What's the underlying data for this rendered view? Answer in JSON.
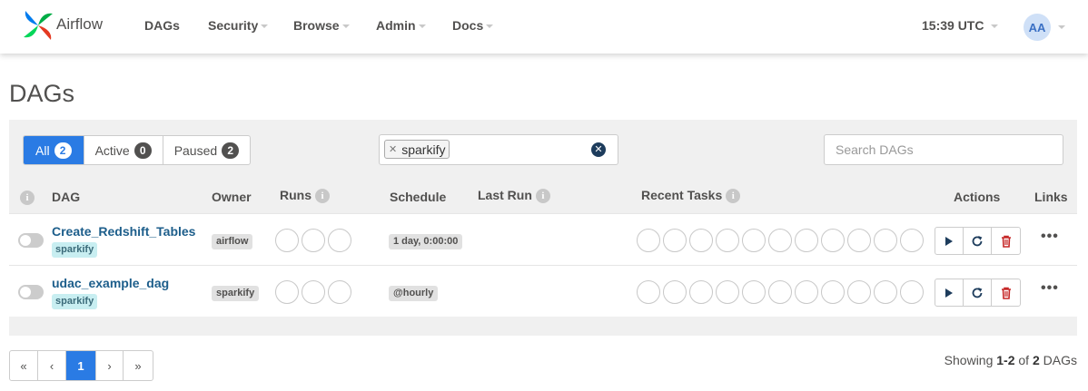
{
  "navbar": {
    "brand": "Airflow",
    "items": [
      {
        "label": "DAGs",
        "caret": false
      },
      {
        "label": "Security",
        "caret": true
      },
      {
        "label": "Browse",
        "caret": true
      },
      {
        "label": "Admin",
        "caret": true
      },
      {
        "label": "Docs",
        "caret": true
      }
    ],
    "clock": "15:39 UTC",
    "avatar_initials": "AA"
  },
  "page_title": "DAGs",
  "filters": {
    "all": {
      "label": "All",
      "count": "2"
    },
    "active": {
      "label": "Active",
      "count": "0"
    },
    "paused": {
      "label": "Paused",
      "count": "2"
    },
    "tag_filter": "sparkify",
    "search_placeholder": "Search DAGs"
  },
  "columns": {
    "dag": "DAG",
    "owner": "Owner",
    "runs": "Runs",
    "schedule": "Schedule",
    "last_run": "Last Run",
    "recent_tasks": "Recent Tasks",
    "actions": "Actions",
    "links": "Links"
  },
  "dags": [
    {
      "name": "Create_Redshift_Tables",
      "tag": "sparkify",
      "owner": "airflow",
      "schedule": "1 day, 0:00:00",
      "last_run": ""
    },
    {
      "name": "udac_example_dag",
      "tag": "sparkify",
      "owner": "sparkify",
      "schedule": "@hourly",
      "last_run": ""
    }
  ],
  "icons": {
    "info": "info-icon",
    "trigger": "play-icon",
    "refresh": "refresh-icon",
    "delete": "trash-icon",
    "links": "ellipsis-icon"
  },
  "colors": {
    "primary": "#2a7be4",
    "dag_link": "#1d5e8b",
    "delete": "#c62828",
    "tag_bg": "#c8eef1"
  },
  "pagination": {
    "first": "«",
    "prev": "‹",
    "current": "1",
    "next": "›",
    "last": "»"
  },
  "showing": {
    "prefix": "Showing",
    "range": "1-2",
    "of": "of",
    "total": "2",
    "suffix": "DAGs"
  }
}
